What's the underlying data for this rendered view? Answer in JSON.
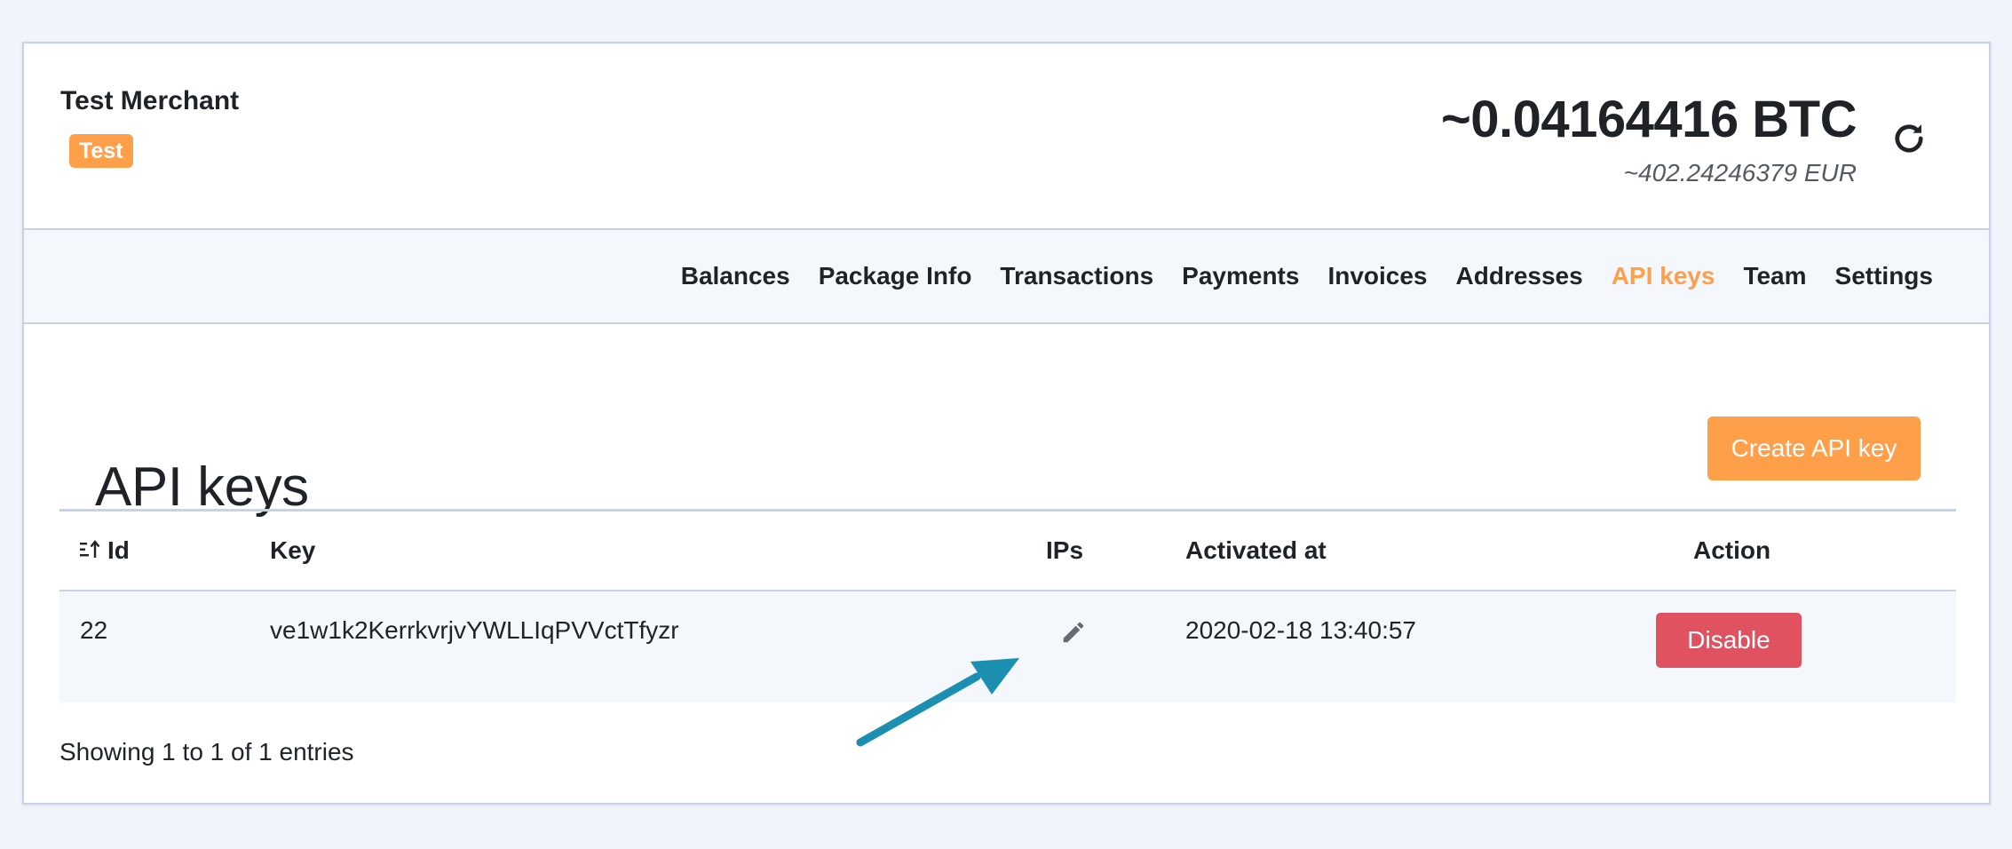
{
  "header": {
    "merchant_name": "Test Merchant",
    "badge": "Test",
    "balance_btc": "~0.04164416 BTC",
    "balance_eur": "~402.24246379 EUR",
    "refresh_icon": "refresh-icon"
  },
  "nav": {
    "items": [
      {
        "label": "Balances",
        "active": false
      },
      {
        "label": "Package Info",
        "active": false
      },
      {
        "label": "Transactions",
        "active": false
      },
      {
        "label": "Payments",
        "active": false
      },
      {
        "label": "Invoices",
        "active": false
      },
      {
        "label": "Addresses",
        "active": false
      },
      {
        "label": "API keys",
        "active": true
      },
      {
        "label": "Team",
        "active": false
      },
      {
        "label": "Settings",
        "active": false
      }
    ]
  },
  "main": {
    "title": "API keys",
    "create_button": "Create API key",
    "table": {
      "columns": [
        "Id",
        "Key",
        "IPs",
        "Activated at",
        "Action"
      ],
      "rows": [
        {
          "id": "22",
          "key": "ve1w1k2KerrkvrjvYWLLIqPVVctTfyzr",
          "ips_icon": "pencil-icon",
          "activated_at": "2020-02-18 13:40:57",
          "action": "Disable"
        }
      ]
    },
    "entries_info": "Showing 1 to 1 of 1 entries"
  },
  "colors": {
    "accent": "#ff9f4a",
    "danger": "#e05260",
    "annotation_arrow": "#1a8fb0"
  }
}
